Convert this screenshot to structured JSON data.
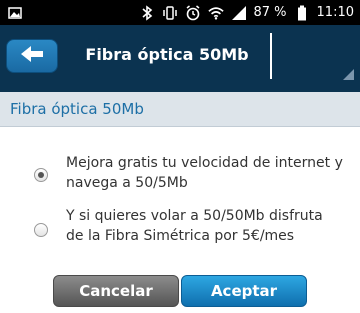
{
  "status_bar": {
    "battery_percent": "87 %",
    "time": "11:10",
    "icons": [
      "image-icon",
      "bluetooth-icon",
      "vibrate-icon",
      "alarm-icon",
      "wifi-icon",
      "signal-icon",
      "battery-icon"
    ]
  },
  "app_bar": {
    "title": "Fibra óptica 50Mb",
    "back_icon": "arrow-left-icon"
  },
  "section": {
    "header": "Fibra óptica 50Mb"
  },
  "options": [
    {
      "line1": "Mejora gratis tu velocidad de internet y",
      "line2": "navega a 50/5Mb",
      "selected": true
    },
    {
      "line1": "Y si quieres volar a 50/50Mb disfruta",
      "line2": "de la Fibra Simétrica por 5€/mes",
      "selected": false
    }
  ],
  "buttons": {
    "cancel": "Cancelar",
    "accept": "Aceptar"
  },
  "colors": {
    "app_bar": "#0b3350",
    "section_header_bg": "#dde4ea",
    "section_header_text": "#1d6fa6",
    "accept": "#1a8ccc",
    "cancel": "#707070"
  }
}
